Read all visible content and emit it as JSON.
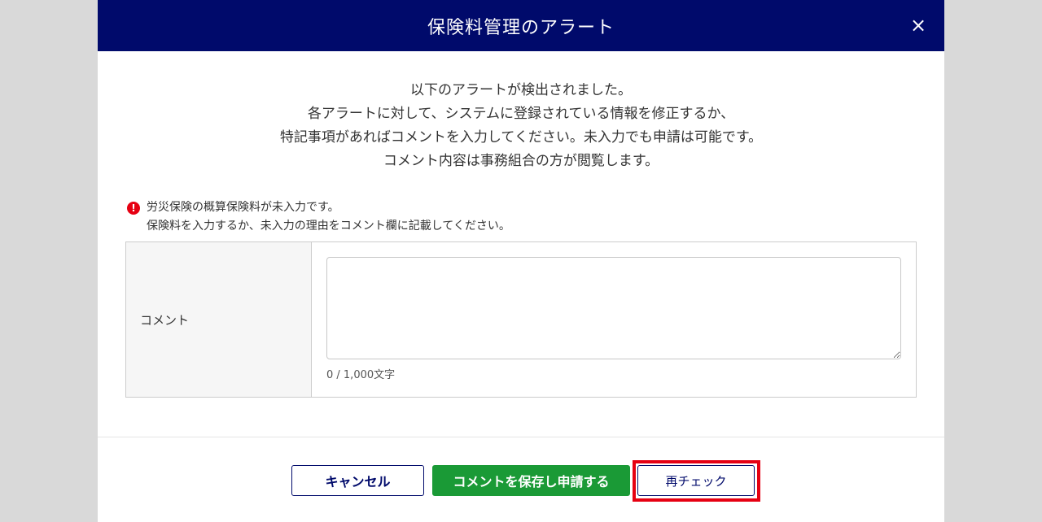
{
  "modal": {
    "title": "保険料管理のアラート",
    "close_icon": "×"
  },
  "intro": {
    "lines": [
      "以下のアラートが検出されました。",
      "各アラートに対して、システムに登録されている情報を修正するか、",
      "特記事項があればコメントを入力してください。未入力でも申請は可能です。",
      "コメント内容は事務組合の方が閲覧します。"
    ]
  },
  "alert": {
    "icon": "!",
    "line1": "労災保険の概算保険料が未入力です。",
    "line2": "保険料を入力するか、未入力の理由をコメント欄に記載してください。"
  },
  "comment": {
    "label": "コメント",
    "value": "",
    "char_count": "0 / 1,000文字"
  },
  "footer": {
    "cancel_label": "キャンセル",
    "save_label": "コメントを保存し申請する",
    "recheck_label": "再チェック"
  },
  "colors": {
    "header": "#000a6b",
    "save": "#1a9a36",
    "alert": "#e60012",
    "highlight": "#e60012"
  }
}
